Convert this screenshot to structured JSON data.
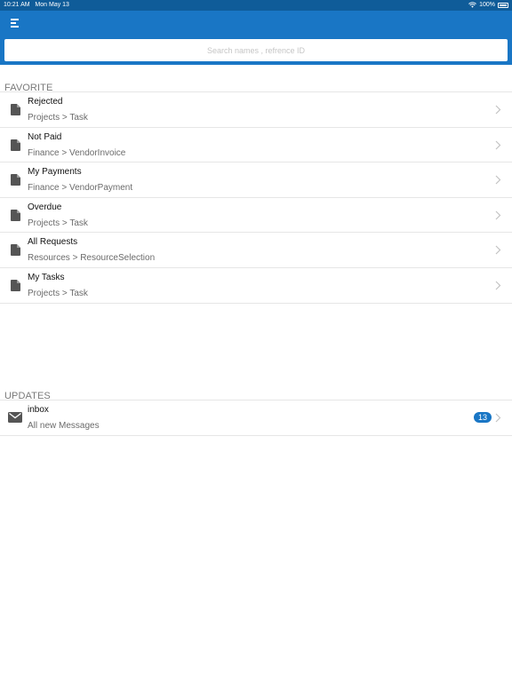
{
  "status_bar": {
    "time": "10:21 AM",
    "date": "Mon May 13",
    "battery": "100%",
    "wifi_icon": "wifi-icon"
  },
  "header": {
    "menu_icon": "menu-icon",
    "search": {
      "placeholder": "Search names , refrence ID",
      "value": ""
    }
  },
  "colors": {
    "accent": "#1976c5",
    "status_bar": "#0f5c99",
    "badge": "#1976c5"
  },
  "favorite": {
    "header": "FAVORITE",
    "items": [
      {
        "title": "Rejected",
        "subtitle": "Projects > Task",
        "icon": "document-icon"
      },
      {
        "title": "Not Paid",
        "subtitle": "Finance > VendorInvoice",
        "icon": "document-icon"
      },
      {
        "title": "My Payments",
        "subtitle": "Finance > VendorPayment",
        "icon": "document-icon"
      },
      {
        "title": "Overdue",
        "subtitle": "Projects > Task",
        "icon": "document-icon"
      },
      {
        "title": "All Requests",
        "subtitle": "Resources > ResourceSelection",
        "icon": "document-icon"
      },
      {
        "title": "My Tasks",
        "subtitle": "Projects > Task",
        "icon": "document-icon"
      }
    ]
  },
  "updates": {
    "header": "UPDATES",
    "items": [
      {
        "title": "inbox",
        "subtitle": "All new Messages",
        "badge": "13",
        "icon": "mail-icon"
      }
    ]
  }
}
